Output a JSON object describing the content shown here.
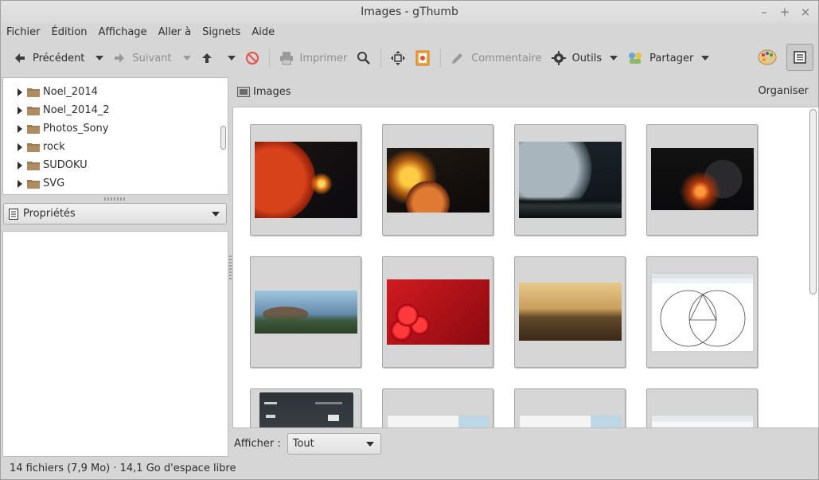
{
  "window": {
    "title": "Images - gThumb"
  },
  "menubar": {
    "items": [
      "Fichier",
      "Édition",
      "Affichage",
      "Aller à",
      "Signets",
      "Aide"
    ]
  },
  "toolbar": {
    "back_label": "Précédent",
    "forward_label": "Suivant",
    "print_label": "Imprimer",
    "comment_label": "Commentaire",
    "tools_label": "Outils",
    "share_label": "Partager"
  },
  "sidebar": {
    "folders": [
      "Noel_2014",
      "Noel_2014_2",
      "Photos_Sony",
      "rock",
      "SUDOKU",
      "SVG"
    ],
    "properties_label": "Propriétés"
  },
  "location": {
    "name": "Images",
    "organize_label": "Organiser"
  },
  "filter": {
    "label": "Afficher :",
    "value": "Tout"
  },
  "status": {
    "text": "14 fichiers (7,9 Mo) · 14,1 Go d'espace libre"
  },
  "colors": {
    "background": "#d6d6d6",
    "thumbnail_frame": "#d6d6d6",
    "selected_toggle": "#c9c9c9"
  }
}
